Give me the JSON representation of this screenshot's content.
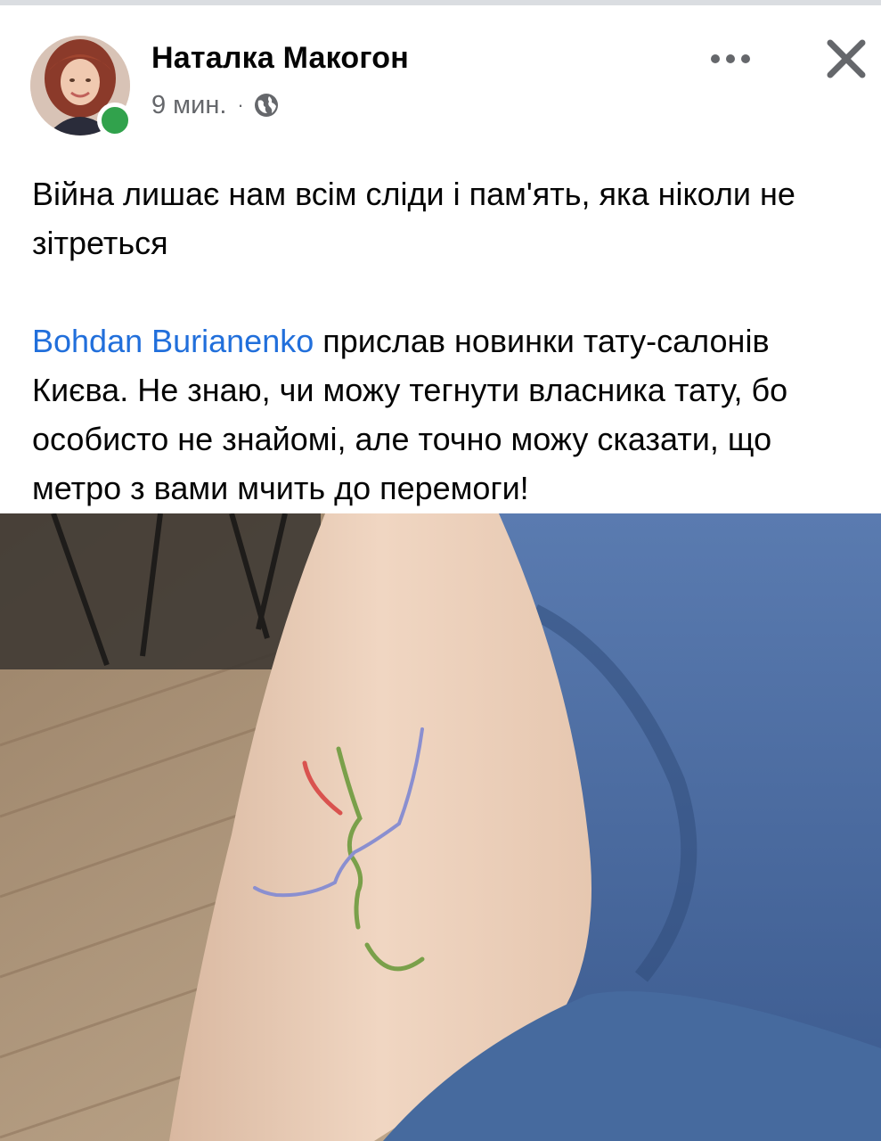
{
  "post": {
    "author": "Наталка Макогон",
    "time": "9 мин.",
    "separator": "·",
    "audience_icon": "globe-icon",
    "text_paragraph_1": "Війна лишає нам всім сліди і пам'ять, яка ніколи не зітреться",
    "mention": "Bohdan Burianenko",
    "text_paragraph_2": " прислав новинки тату-салонів Києва. Не знаю, чи можу тегнути власника тату, бо особисто не знайомі, але точно можу сказати, що метро з вами мчить до перемоги!"
  },
  "colors": {
    "mention": "#216fdb",
    "online": "#31a24c",
    "meta_text": "#65676b",
    "tattoo_red": "#d9534f",
    "tattoo_blue": "#8a8fd0",
    "tattoo_green": "#7aa04a"
  },
  "icons": {
    "more": "more-options-icon",
    "close": "close-icon",
    "audience": "globe-icon"
  }
}
